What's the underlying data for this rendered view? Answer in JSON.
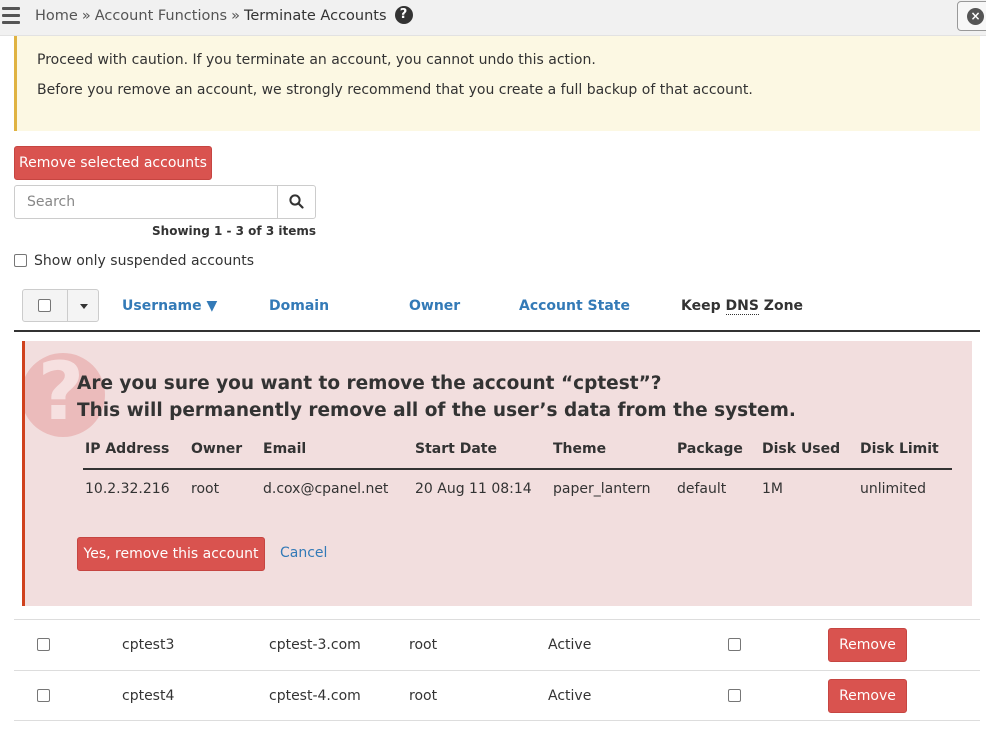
{
  "breadcrumb": {
    "items": [
      "Home",
      "Account Functions"
    ],
    "separator": "»",
    "current": "Terminate Accounts",
    "help_icon": "?"
  },
  "warning": {
    "line1": "Proceed with caution. If you terminate an account, you cannot undo this action.",
    "line2": "Before you remove an account, we strongly recommend that you create a full backup of that account."
  },
  "actions": {
    "remove_selected_label": "Remove selected accounts"
  },
  "search": {
    "placeholder": "Search",
    "value": ""
  },
  "paging": {
    "showing_text": "Showing 1 - 3 of 3 items"
  },
  "filters": {
    "suspended_label": "Show only suspended accounts",
    "suspended_checked": false
  },
  "table": {
    "columns": {
      "username": "Username ▼",
      "domain": "Domain",
      "owner": "Owner",
      "account_state": "Account State",
      "keep_prefix": "Keep ",
      "keep_abbr": "DNS",
      "keep_suffix": " Zone"
    },
    "rows": [
      {
        "username": "cptest3",
        "domain": "cptest-3.com",
        "owner": "root",
        "state": "Active",
        "remove_label": "Remove"
      },
      {
        "username": "cptest4",
        "domain": "cptest-4.com",
        "owner": "root",
        "state": "Active",
        "remove_label": "Remove"
      }
    ]
  },
  "confirm": {
    "question_line1": "Are you sure you want to remove the account “cptest”?",
    "question_line2": "This will permanently remove all of the user’s data from the system.",
    "headers": {
      "ip": "IP Address",
      "owner": "Owner",
      "email": "Email",
      "start_date": "Start Date",
      "theme": "Theme",
      "package": "Package",
      "disk_used": "Disk Used",
      "disk_limit": "Disk Limit"
    },
    "values": {
      "ip": "10.2.32.216",
      "owner": "root",
      "email": "d.cox@cpanel.net",
      "start_date": "20 Aug 11 08:14",
      "theme": "paper_lantern",
      "package": "default",
      "disk_used": "1M",
      "disk_limit": "unlimited"
    },
    "yes_label": "Yes, remove this account",
    "cancel_label": "Cancel"
  },
  "colors": {
    "danger": "#d9534f",
    "link": "#337ab7",
    "warning_bg": "#fcf8e3",
    "confirm_bg": "#f2dede"
  }
}
